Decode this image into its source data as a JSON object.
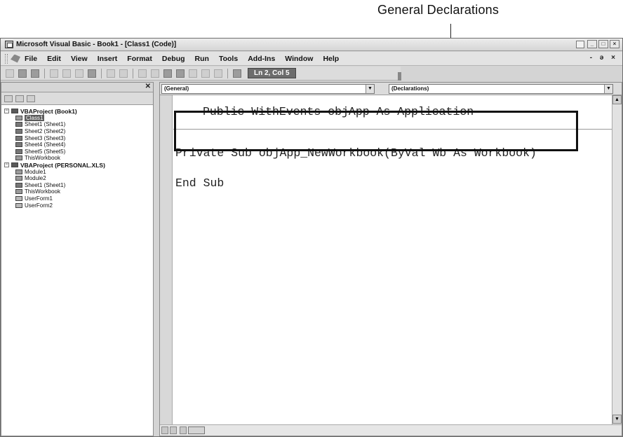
{
  "callout": {
    "label": "General Declarations"
  },
  "window": {
    "title": "Microsoft Visual Basic - Book1 - [Class1 (Code)]",
    "mdi_controls": "- ə ×"
  },
  "menu": {
    "items": [
      "File",
      "Edit",
      "View",
      "Insert",
      "Format",
      "Debug",
      "Run",
      "Tools",
      "Add-Ins",
      "Window",
      "Help"
    ]
  },
  "toolbar": {
    "position": "Ln 2, Col 5"
  },
  "project": {
    "tree": [
      {
        "label": "VBAProject (Book1)",
        "type": "project",
        "level": 0
      },
      {
        "label": "Class1",
        "type": "class",
        "level": 1,
        "selected": true
      },
      {
        "label": "Sheet1 (Sheet1)",
        "type": "sheet",
        "level": 1
      },
      {
        "label": "Sheet2 (Sheet2)",
        "type": "sheet",
        "level": 1
      },
      {
        "label": "Sheet3 (Sheet3)",
        "type": "sheet",
        "level": 1
      },
      {
        "label": "Sheet4 (Sheet4)",
        "type": "sheet",
        "level": 1
      },
      {
        "label": "Sheet5 (Sheet5)",
        "type": "sheet",
        "level": 1
      },
      {
        "label": "ThisWorkbook",
        "type": "workbook",
        "level": 1
      },
      {
        "label": "VBAProject (PERSONAL.XLS)",
        "type": "project",
        "level": 0
      },
      {
        "label": "Module1",
        "type": "module",
        "level": 1
      },
      {
        "label": "Module2",
        "type": "module",
        "level": 1
      },
      {
        "label": "Sheet1 (Sheet1)",
        "type": "sheet",
        "level": 1
      },
      {
        "label": "ThisWorkbook",
        "type": "workbook",
        "level": 1
      },
      {
        "label": "UserForm1",
        "type": "form",
        "level": 1
      },
      {
        "label": "UserForm2",
        "type": "form",
        "level": 1
      }
    ]
  },
  "code": {
    "object_combo": "(General)",
    "procedure_combo": "(Declarations)",
    "lines": [
      "Public WithEvents objApp As Application",
      "Private Sub objApp_NewWorkbook(ByVal Wb As Workbook)",
      "End Sub"
    ]
  }
}
